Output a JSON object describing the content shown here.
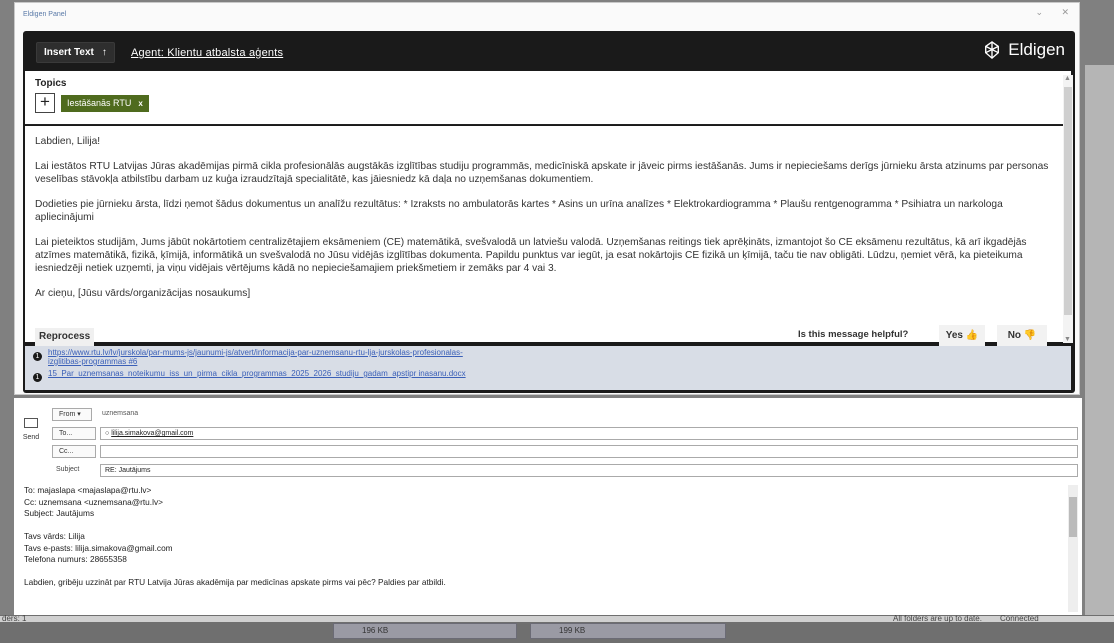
{
  "panel": {
    "title": "Eldigen Panel",
    "min": "⌄",
    "close": "✕"
  },
  "toolbar": {
    "insert_text": "Insert Text",
    "insert_arrow": "↑",
    "agent_prefix": "Agent:",
    "agent_name": "Klientu atbalsta aģents",
    "brand": "Eldigen"
  },
  "topics": {
    "label": "Topics",
    "plus": "+",
    "tag": "Iestāšanās RTU",
    "tag_remove": "x"
  },
  "message": {
    "greeting": "Labdien, Lilija!",
    "p1": "Lai iestātos RTU Latvijas Jūras akadēmijas pirmā cikla profesionālās augstākās izglītības studiju programmās, medicīniskā apskate ir jāveic pirms iestāšanās. Jums ir nepieciešams derīgs jūrnieku ārsta atzinums par personas veselības stāvokļa atbilstību darbam uz kuģa izraudzītajā specialitātē, kas jāiesniedz kā daļa no uzņemšanas dokumentiem.",
    "p2": "Dodieties pie jūrnieku ārsta, līdzi ņemot šādus dokumentus un analīžu rezultātus: * Izraksts no ambulatorās kartes * Asins un urīna analīzes * Elektrokardiogramma * Plaušu rentgenogramma * Psihiatra un narkologa apliecinājumi",
    "p3": "Lai pieteiktos studijām, Jums jābūt nokārtotiem centralizētajiem eksāmeniem (CE) matemātikā, svešvalodā un latviešu valodā. Uzņemšanas reitings tiek aprēķināts, izmantojot šo CE eksāmenu rezultātus, kā arī ikgadējās atzīmes matemātikā, fizikā, ķīmijā, informātikā un svešvalodā no Jūsu vidējās izglītības dokumenta. Papildu punktus var iegūt, ja esat nokārtojis CE fizikā un ķīmijā, taču tie nav obligāti. Lūdzu, ņemiet vērā, ka pieteikuma iesniedzēji netiek uzņemti, ja viņu vidējais vērtējums kādā no nepieciešamajiem priekšmetiem ir zemāks par 4 vai 3.",
    "closing": "Ar cieņu, [Jūsu vārds/organizācijas nosaukums]"
  },
  "feedback": {
    "reprocess": "Reprocess",
    "question": "Is this message helpful?",
    "yes": "Yes",
    "no": "No"
  },
  "sources": [
    {
      "num": "1",
      "text": "https://www.rtu.lv/lv/jurskola/par-mums-js/jaunumi-js/atvert/informacija-par-uznemsanu-rtu-ljа-jurskolas-profesionalas-izglitibas-programmas #6"
    },
    {
      "num": "1",
      "text": "15_Par_uznemsanas_noteikumu_iss_un_pirma_cikla_programmas_2025_2026_studiju_gadam_apstipr inasanu.docx"
    }
  ],
  "compose": {
    "send": "Send",
    "from_btn": "From ▾",
    "from_value": "uznemsana",
    "to_btn": "To...",
    "to_value": "lilija.simakova@gmail.com",
    "cc_btn": "Cc...",
    "cc_value": "",
    "subject_label": "Subject",
    "subject_value": "RE: Jautājums"
  },
  "original_mail": [
    "To: majaslapa <majaslapa@rtu.lv>",
    "Cc: uznemsana <uznemsana@rtu.lv>",
    "Subject: Jautājums",
    "",
    "Tavs vārds: Lilija",
    "Tavs e-pasts: lilija.simakova@gmail.com",
    "Telefona numurs: 28655358",
    "",
    "Labdien, gribēju uzzināt par RTU Latvija Jūras akadēmija par medicīnas apskate pirms vai pēc? Paldies par atbildi."
  ],
  "background": {
    "att1": "196 KB",
    "att2": "199 KB",
    "status_left": "ders: 1",
    "status_mid": "All folders are up to date.",
    "status_right": "Connected"
  },
  "colors": {
    "frame": "#1a1a1a",
    "tag": "#4f6b1e",
    "link": "#3b60b8",
    "links_bg": "#d8dde6"
  }
}
